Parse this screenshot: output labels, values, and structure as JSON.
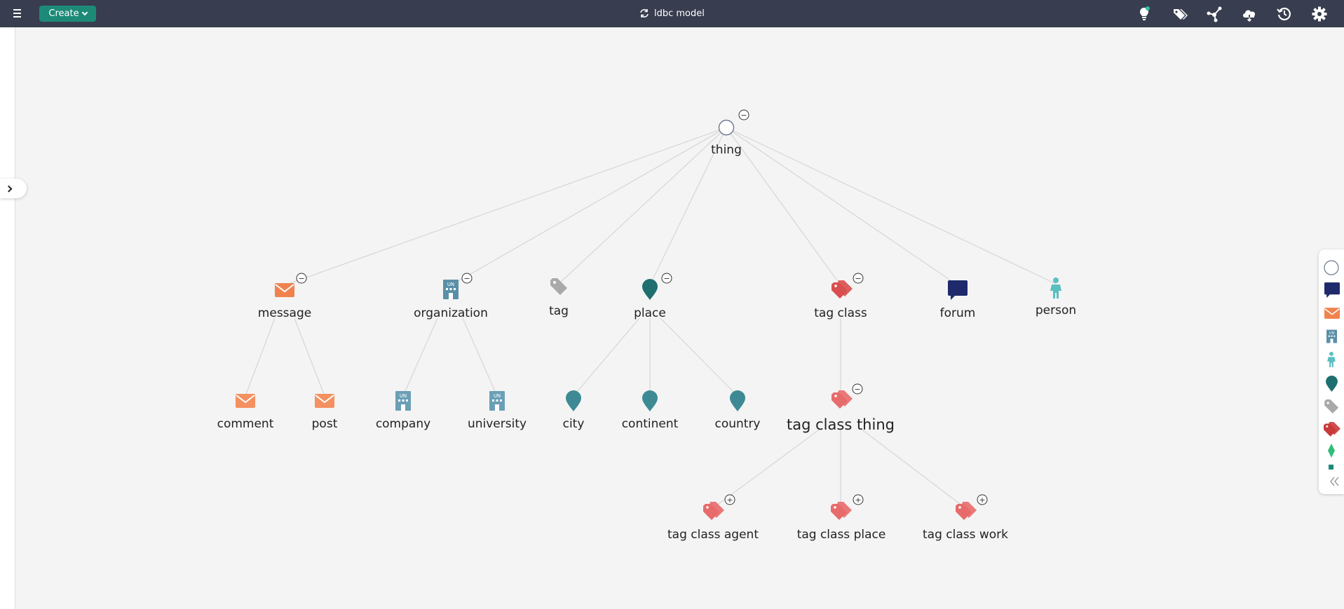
{
  "header": {
    "create_label": "Create",
    "title": "ldbc model",
    "icons": [
      "lightbulb-icon",
      "tags-icon",
      "graph-icon",
      "cloud-icon",
      "history-icon",
      "settings-icon"
    ]
  },
  "diagram": {
    "root": {
      "label": "thing",
      "toggle": "−"
    },
    "children": [
      {
        "label": "message",
        "toggle": "−",
        "icon": "message-icon"
      },
      {
        "label": "organization",
        "toggle": "−",
        "icon": "organization-icon"
      },
      {
        "label": "tag",
        "icon": "tag-icon"
      },
      {
        "label": "place",
        "toggle": "−",
        "icon": "place-icon"
      },
      {
        "label": "tag class",
        "toggle": "−",
        "icon": "tag-class-icon"
      },
      {
        "label": "forum",
        "icon": "forum-icon"
      },
      {
        "label": "person",
        "icon": "person-icon"
      }
    ],
    "grandchildren": [
      {
        "label": "comment",
        "parent": "message"
      },
      {
        "label": "post",
        "parent": "message"
      },
      {
        "label": "company",
        "parent": "organization"
      },
      {
        "label": "university",
        "parent": "organization"
      },
      {
        "label": "city",
        "parent": "place"
      },
      {
        "label": "continent",
        "parent": "place"
      },
      {
        "label": "country",
        "parent": "place"
      },
      {
        "label": "tag class thing",
        "parent": "tag class",
        "toggle": "−"
      }
    ],
    "leaves": [
      {
        "label": "tag class agent",
        "toggle": "+"
      },
      {
        "label": "tag class place",
        "toggle": "+"
      },
      {
        "label": "tag class work",
        "toggle": "+"
      }
    ]
  },
  "colors": {
    "header_bg": "#383d4f",
    "create_bg": "#1d8a78",
    "message": "#f0834d",
    "organization": "#5b8fa8",
    "tag": "#a9a9a9",
    "place": "#1e6f6f",
    "place_child": "#3d8a94",
    "tag_class": "#d94f4f",
    "tag_class_child": "#e86b6b",
    "forum": "#1e2a6b",
    "person": "#5bbfc0",
    "edge": "#d6d6d6"
  },
  "legend": {
    "icons": [
      "thing-icon",
      "forum-icon",
      "message-icon",
      "organization-icon",
      "person-icon",
      "place-icon",
      "tag-icon",
      "tag-class-icon",
      "diamond-icon",
      "square-icon",
      "collapse-icon"
    ]
  }
}
